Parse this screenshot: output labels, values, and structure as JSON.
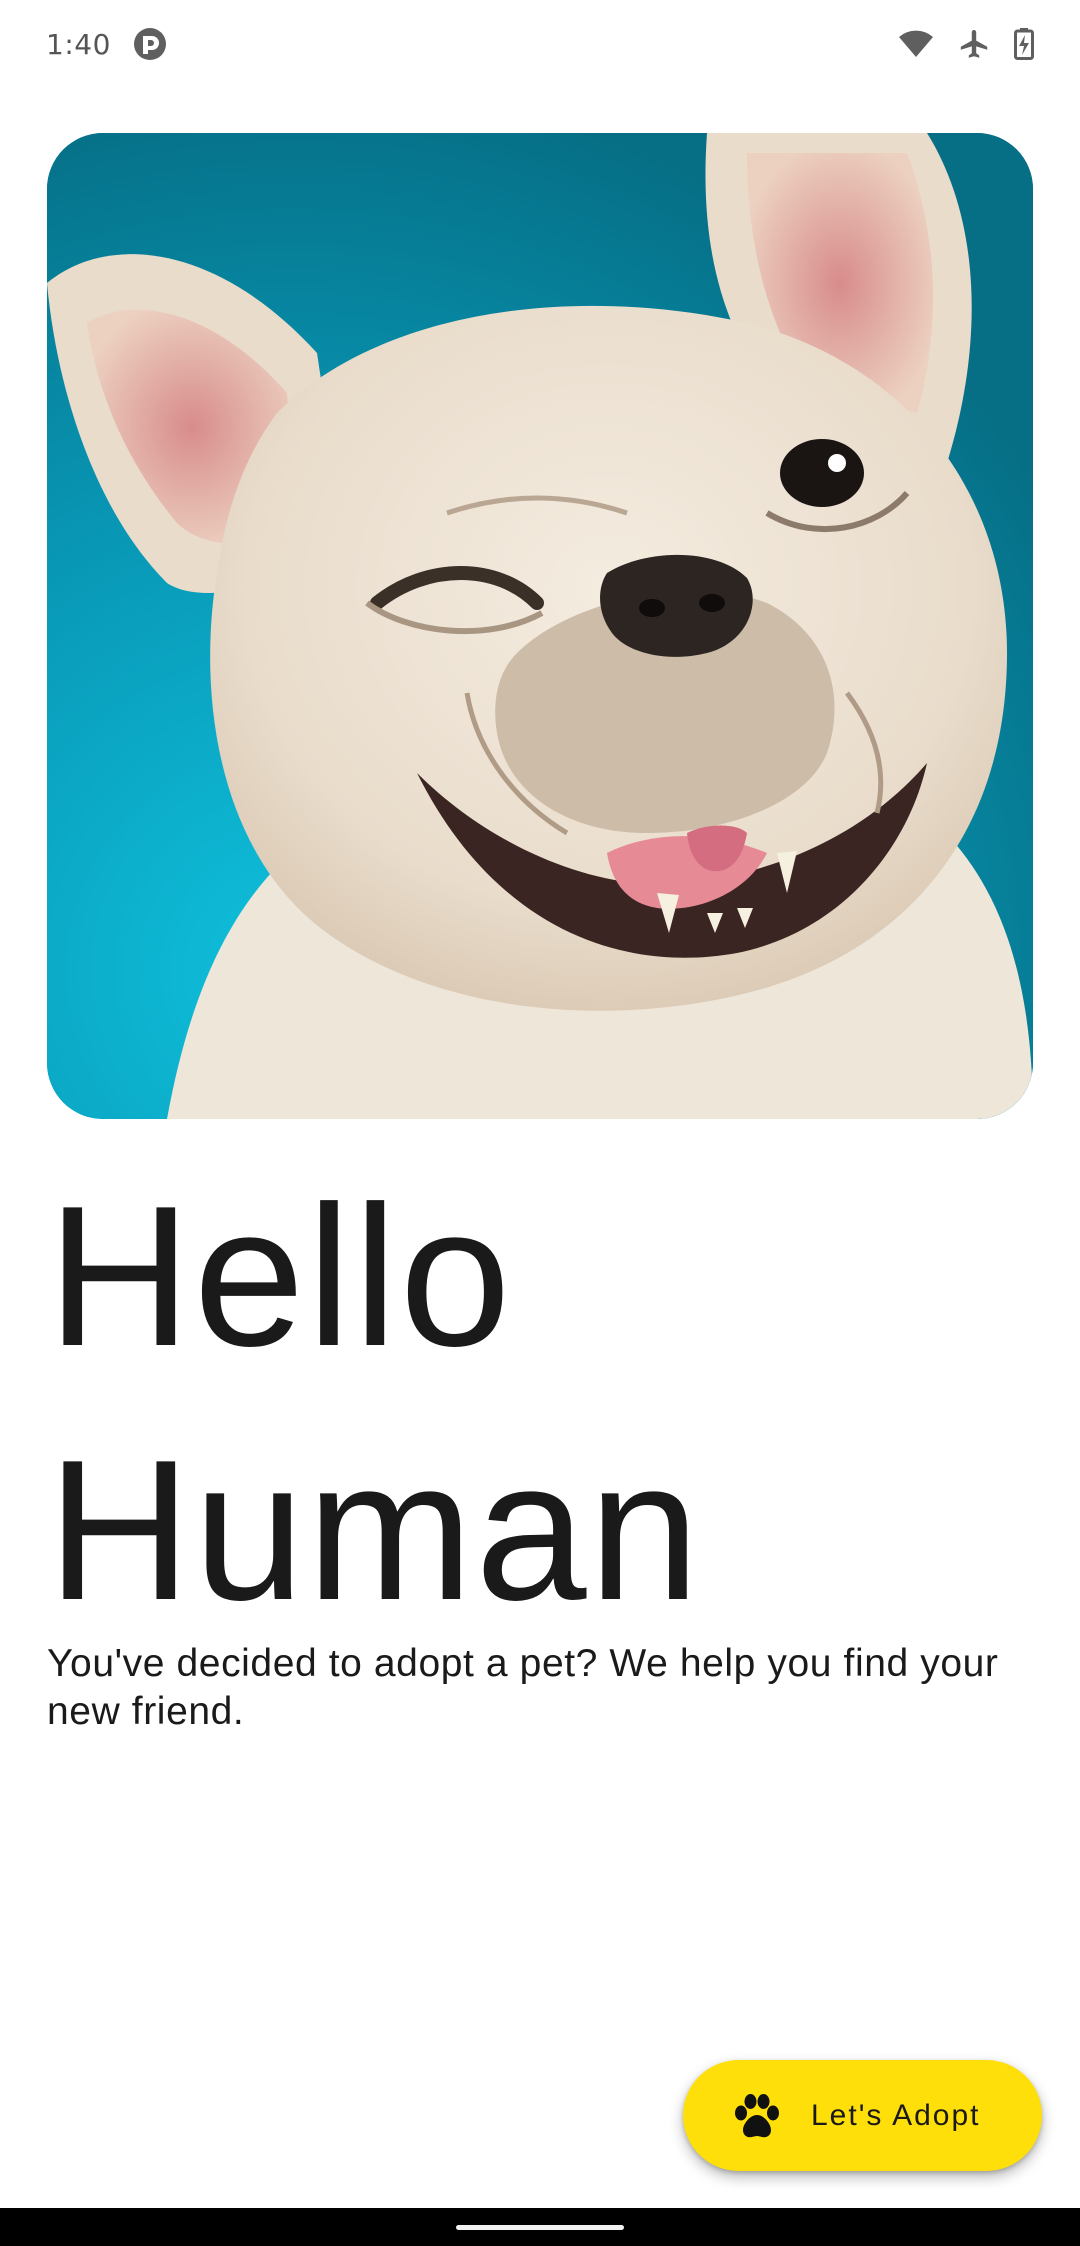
{
  "status_bar": {
    "time": "1:40",
    "icons": [
      "app-notification-icon",
      "wifi-icon",
      "airplane-mode-icon",
      "battery-charging-icon"
    ]
  },
  "hero": {
    "image": "winking-french-bulldog-photo",
    "background_color": "#0a93b3"
  },
  "headline": {
    "line1": "Hello",
    "line2": "Human"
  },
  "description": "You've decided to adopt a pet? We help you find your new friend.",
  "fab": {
    "icon": "paw-icon",
    "label": "Let's Adopt",
    "color": "#ffdf0a"
  },
  "nav_bar": {
    "handle": "gesture-handle"
  }
}
